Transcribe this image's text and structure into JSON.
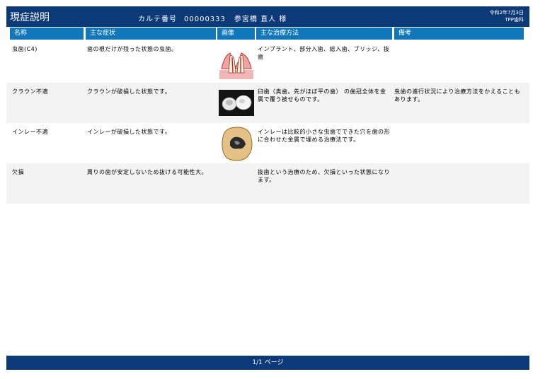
{
  "header": {
    "title": "現症説明",
    "chart_label": "カルテ番号",
    "chart_number": "00000333",
    "patient": "参宮橋 直人 様",
    "date": "令和2年7月3日",
    "clinic": "TPP歯科"
  },
  "columns": [
    "名称",
    "主な症状",
    "画像",
    "主な治療方法",
    "備考"
  ],
  "rows": [
    {
      "name": "虫歯(C4)",
      "symptom": "歯の根だけが残った状態の虫歯。",
      "treatment": "インプラント、部分入歯、総入歯、ブリッジ、抜歯",
      "note": ""
    },
    {
      "name": "クラウン不適",
      "symptom": "クラウンが破損した状態です。",
      "treatment": "臼歯（奥歯。先がほぼ平の歯） の歯冠全体を金属で覆う被せものです。",
      "note": "虫歯の進行状況により治療方法をかえることもあります。"
    },
    {
      "name": "インレー不適",
      "symptom": "インレーが破損した状態です。",
      "treatment": "インレーは比較的小さな虫歯でできた穴を歯の形に合わせた金属で埋める治療法です。",
      "note": ""
    },
    {
      "name": "欠損",
      "symptom": "周りの歯が安定しないため抜ける可能性大。",
      "treatment": "抜歯という治療のため、欠損といった状態になります。",
      "note": ""
    }
  ],
  "footer": {
    "page": "1/1 ページ"
  }
}
